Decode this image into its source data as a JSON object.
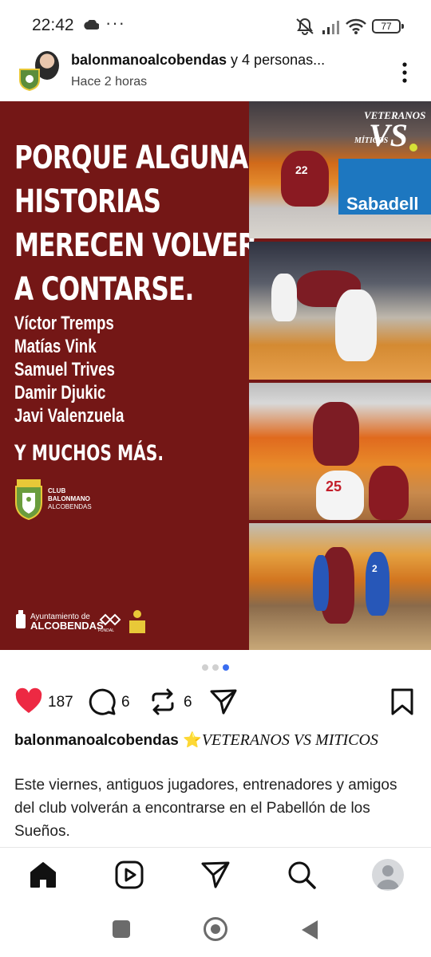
{
  "status_bar": {
    "time": "22:42",
    "dots": "···",
    "battery": "77",
    "icons": [
      "cloud-icon",
      "mute-icon",
      "signal-icon",
      "wifi-icon",
      "battery-icon"
    ]
  },
  "post": {
    "username": "balonmanoalcobendas",
    "coauthors": " y 4 personas...",
    "time": "Hace 2 horas",
    "image": {
      "headline": [
        "PORQUE ALGUNAS",
        "HISTORIAS",
        "MERECEN VOLVER",
        "A CONTARSE."
      ],
      "names": [
        "Víctor Tremps",
        "Matías Vink",
        "Samuel Trives",
        "Damir Djukic",
        "Javi Valenzuela"
      ],
      "more": "Y MUCHOS MÁS.",
      "club_name": [
        "CLUB",
        "BALONMANO",
        "ALCOBENDAS"
      ],
      "sponsor_line1": "Ayuntamiento de",
      "sponsor_line2": "ALCOBENDAS",
      "sponsor_fundal": "FUNDAL",
      "photo_banner": "Sabadell",
      "jersey_numbers": [
        "22",
        "25",
        "2"
      ],
      "vs_logo": [
        "VETERANOS",
        "VS",
        "MÍTICOS"
      ],
      "background_color": "#741716"
    },
    "carousel": {
      "count": 3,
      "active": 2,
      "active_color": "#3a6df0"
    },
    "likes": "187",
    "comments": "6",
    "reposts": "6",
    "like_color": "#ed2943",
    "caption_user": "balonmanoalcobendas",
    "caption_emoji": "⭐",
    "caption_title": "VETERANOS VS MITICOS",
    "caption_body": "Este viernes, antiguos jugadores, entrenadores y amigos del club volverán a encontrarse en el Pabellón de los Sueños."
  },
  "bottom_nav": [
    "home-icon",
    "reels-icon",
    "send-icon",
    "search-icon",
    "profile-avatar"
  ],
  "system_nav": [
    "recents-button",
    "home-button",
    "back-button"
  ]
}
